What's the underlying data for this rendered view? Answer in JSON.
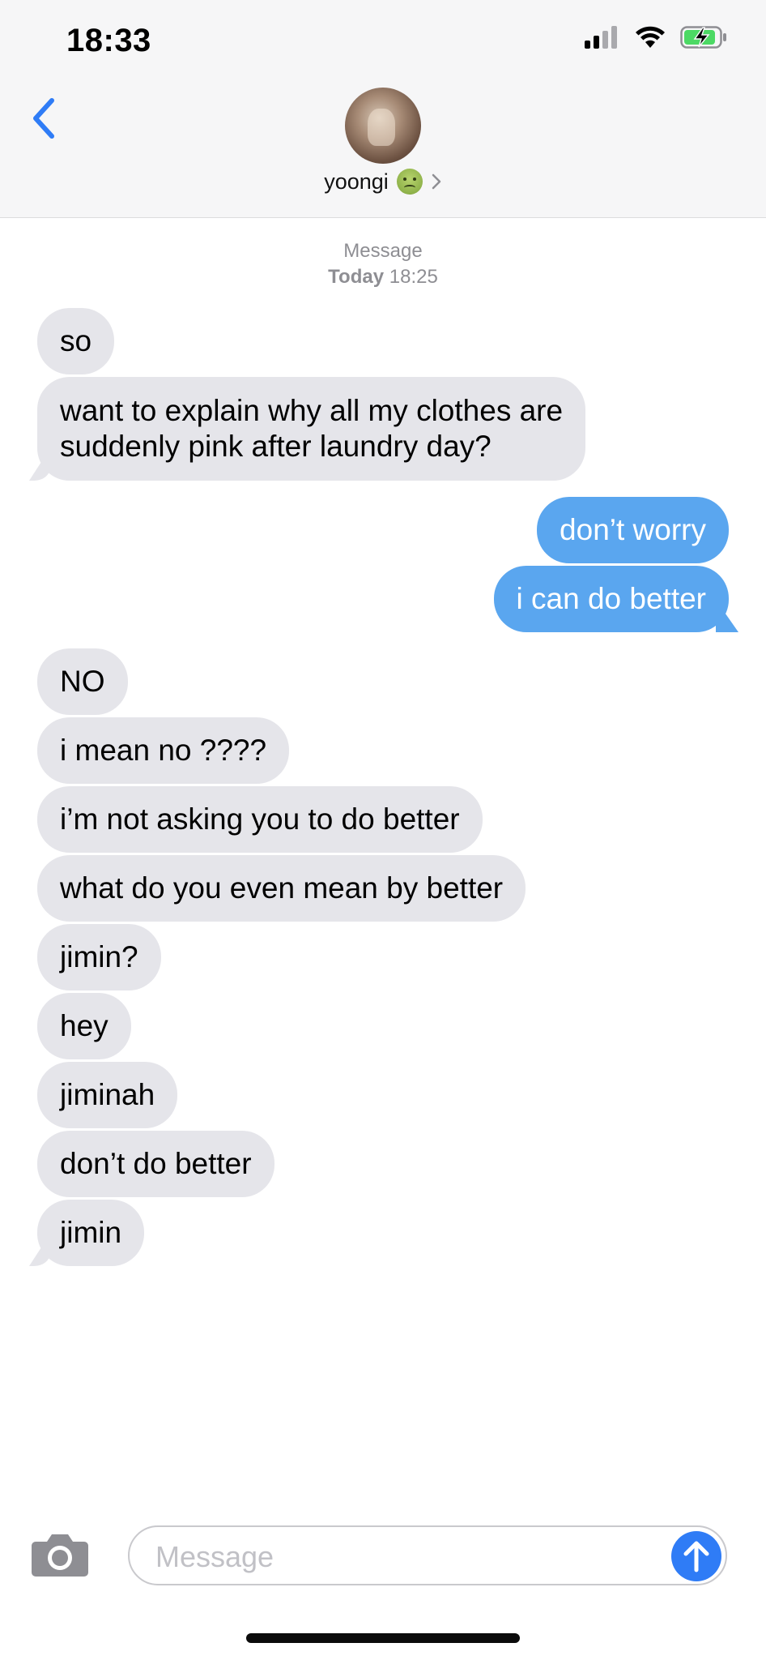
{
  "status_bar": {
    "time": "18:33"
  },
  "header": {
    "contact_name": "yoongi"
  },
  "timestamp": {
    "service": "Message",
    "day": "Today",
    "time": "18:25"
  },
  "messages": [
    {
      "from": "them",
      "lines": [
        "so"
      ]
    },
    {
      "from": "them",
      "lines": [
        "want to explain why all my clothes are",
        "suddenly pink after laundry day?"
      ]
    },
    {
      "from": "me",
      "lines": [
        "don’t worry"
      ]
    },
    {
      "from": "me",
      "lines": [
        "i can do better"
      ]
    },
    {
      "from": "them",
      "lines": [
        "NO"
      ]
    },
    {
      "from": "them",
      "lines": [
        "i mean no ????"
      ]
    },
    {
      "from": "them",
      "lines": [
        "i’m not asking you to do better"
      ]
    },
    {
      "from": "them",
      "lines": [
        "what do you even mean by better"
      ]
    },
    {
      "from": "them",
      "lines": [
        "jimin?"
      ]
    },
    {
      "from": "them",
      "lines": [
        "hey"
      ]
    },
    {
      "from": "them",
      "lines": [
        "jiminah"
      ]
    },
    {
      "from": "them",
      "lines": [
        "don’t do better"
      ]
    },
    {
      "from": "them",
      "lines": [
        "jimin"
      ]
    }
  ],
  "composer": {
    "placeholder": "Message"
  },
  "colors": {
    "incoming_bubble": "#e5e5ea",
    "outgoing_bubble": "#5aa6ef",
    "accent": "#2f7cf6"
  },
  "icons": [
    "back-chevron-icon",
    "camera-icon",
    "send-arrow-icon",
    "signal-icon",
    "wifi-icon",
    "battery-charging-icon",
    "chevron-right-icon"
  ]
}
